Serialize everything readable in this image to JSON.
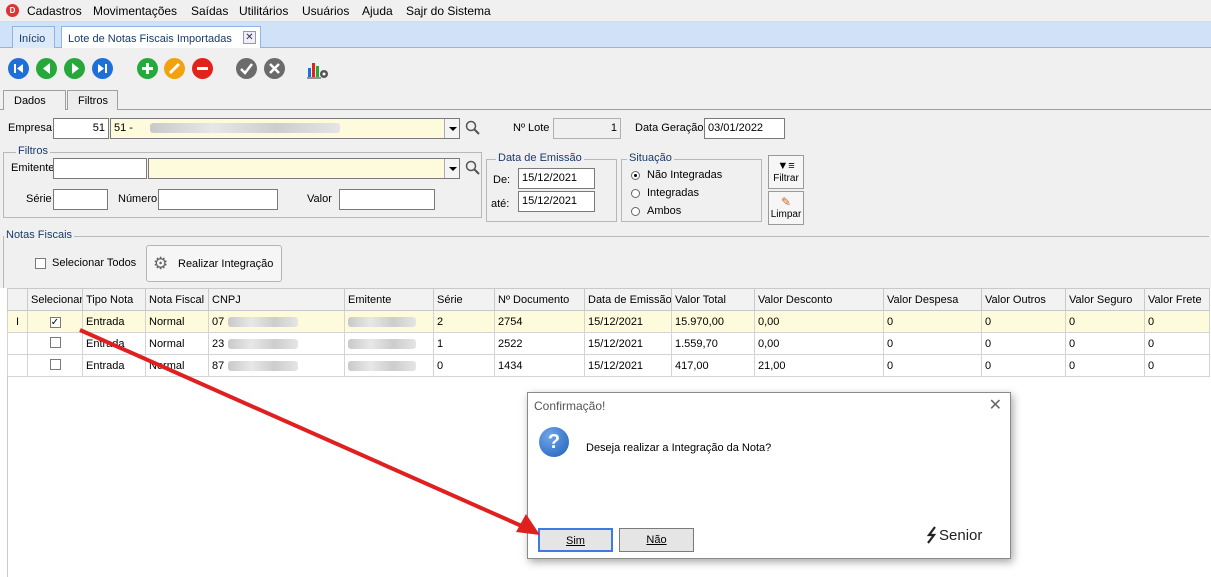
{
  "menu": [
    "Cadastros",
    "Movimentações",
    "Saídas",
    "Utilitários",
    "Usuários",
    "Ajuda",
    "Sajr do Sistema"
  ],
  "tabs": {
    "home": "Início",
    "current": "Lote de Notas Fiscais Importadas"
  },
  "subtabs": [
    "Dados",
    "Filtros"
  ],
  "form": {
    "empresa_label": "Empresa",
    "empresa_code": "51",
    "empresa_name": "51 -",
    "lote_label": "Nº Lote",
    "lote_value": "1",
    "data_geracao_label": "Data Geração",
    "data_geracao_value": "03/01/2022",
    "filtros_title": "Filtros",
    "emitente_label": "Emitente",
    "serie_label": "Série",
    "numero_label": "Número",
    "valor_label": "Valor",
    "data_emissao_title": "Data de Emissão",
    "de_label": "De:",
    "de_value": "15/12/2021",
    "ate_label": "até:",
    "ate_value": "15/12/2021",
    "situacao_title": "Situação",
    "situacao_options": [
      "Não Integradas",
      "Integradas",
      "Ambos"
    ],
    "situacao_selected": "Não Integradas",
    "filtrar_label": "Filtrar",
    "limpar_label": "Limpar",
    "notas_title": "Notas Fiscais",
    "selecionar_todos": "Selecionar Todos",
    "realizar_integracao": "Realizar Integração"
  },
  "grid": {
    "columns": [
      "Selecionar",
      "Tipo Nota",
      "Nota Fiscal",
      "CNPJ",
      "Emitente",
      "Série",
      "Nº Documento",
      "Data de Emissão",
      "Valor Total",
      "Valor Desconto",
      "Valor Despesa",
      "Valor Outros",
      "Valor Seguro",
      "Valor Frete"
    ],
    "rows": [
      {
        "checked": true,
        "tipo": "Entrada",
        "nota": "Normal",
        "cnpj": "07",
        "serie": "2",
        "doc": "2754",
        "data": "15/12/2021",
        "total": "15.970,00",
        "desconto": "0,00",
        "despesa": "0",
        "outros": "0",
        "seguro": "0",
        "frete": "0"
      },
      {
        "checked": false,
        "tipo": "Entrada",
        "nota": "Normal",
        "cnpj": "23",
        "serie": "1",
        "doc": "2522",
        "data": "15/12/2021",
        "total": "1.559,70",
        "desconto": "0,00",
        "despesa": "0",
        "outros": "0",
        "seguro": "0",
        "frete": "0"
      },
      {
        "checked": false,
        "tipo": "Entrada",
        "nota": "Normal",
        "cnpj": "87",
        "serie": "0",
        "doc": "1434",
        "data": "15/12/2021",
        "total": "417,00",
        "desconto": "21,00",
        "despesa": "0",
        "outros": "0",
        "seguro": "0",
        "frete": "0"
      }
    ]
  },
  "dialog": {
    "title": "Confirmação!",
    "message": "Deseja realizar a Integração da Nota?",
    "yes": "Sim",
    "no": "Não",
    "brand": "Senior"
  },
  "colors": {
    "tab_bg": "#cfe2f7",
    "selected_row": "#fdfbdc",
    "arrow": "#e02020",
    "brand_blue": "#1565c0",
    "dialog_icon": "#1f5fb8"
  }
}
